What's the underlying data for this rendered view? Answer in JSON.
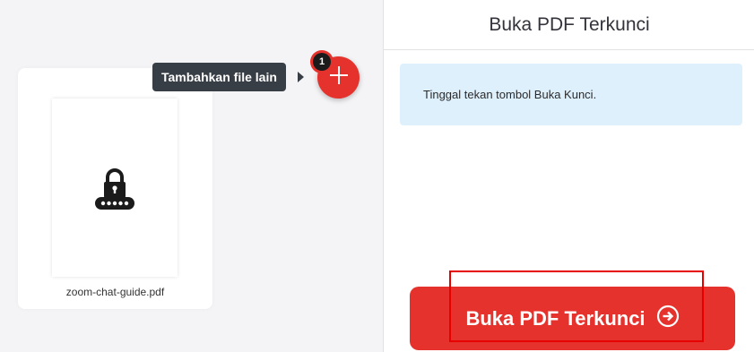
{
  "workspace": {
    "file_name": "zoom-chat-guide.pdf",
    "tooltip": "Tambahkan file lain",
    "file_count": "1",
    "file_icon": "lock-password-icon",
    "add_icon": "plus-icon"
  },
  "sidebar": {
    "title": "Buka PDF Terkunci",
    "info_text": "Tinggal tekan tombol Buka Kunci.",
    "action_label": "Buka PDF Terkunci",
    "action_icon": "arrow-right-circle-icon"
  },
  "colors": {
    "accent": "#e5322d",
    "info_background": "#dff0fd",
    "workspace_background": "#f4f4f6",
    "tooltip_background": "#383e45",
    "highlight": "#e60000"
  }
}
